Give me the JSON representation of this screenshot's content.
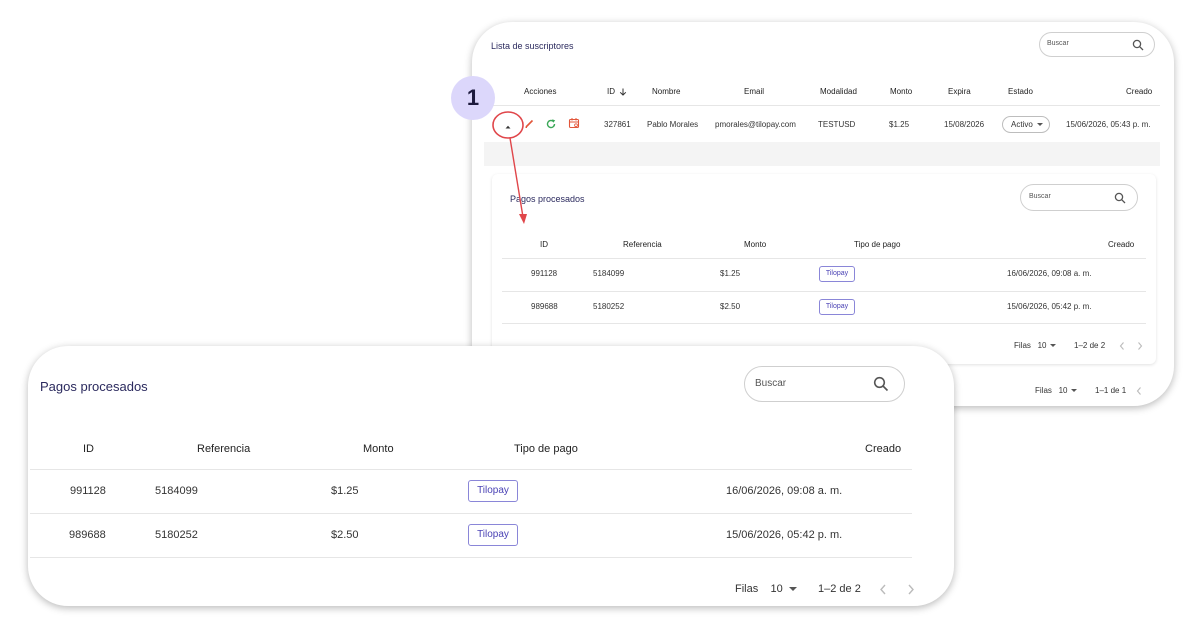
{
  "subscribers": {
    "title": "Lista de suscriptores",
    "search_placeholder": "Buscar",
    "columns": [
      "Acciones",
      "ID",
      "Nombre",
      "Email",
      "Modalidad",
      "Monto",
      "Expira",
      "Estado",
      "Creado"
    ],
    "id_sort_icon": "arrow-down-icon",
    "row": {
      "id": "327861",
      "name": "Pablo Morales",
      "email": "pmorales@tilopay.com",
      "modality": "TESTUSD",
      "amount": "$1.25",
      "expires": "15/08/2026",
      "status": "Activo",
      "created": "15/06/2026, 05:43 p. m."
    },
    "action_icons": [
      "collapse-icon",
      "edit-icon",
      "refresh-icon",
      "calendar-icon"
    ],
    "footer": {
      "rows_label": "Filas",
      "rows_value": "10",
      "range": "1–1 de 1"
    }
  },
  "payments": {
    "title": "Pagos procesados",
    "search_placeholder": "Buscar",
    "columns": [
      "ID",
      "Referencia",
      "Monto",
      "Tipo de pago",
      "Creado"
    ],
    "rows": [
      {
        "id": "991128",
        "reference": "5184099",
        "amount": "$1.25",
        "type": "Tilopay",
        "created": "16/06/2026, 09:08 a. m."
      },
      {
        "id": "989688",
        "reference": "5180252",
        "amount": "$2.50",
        "type": "Tilopay",
        "created": "15/06/2026, 05:42 p. m."
      }
    ],
    "footer": {
      "rows_label": "Filas",
      "rows_value": "10",
      "range": "1–2 de 2"
    }
  },
  "step_number": "1",
  "colors": {
    "accent": "#4b43b5",
    "step_circle": "#dcd7fb",
    "annotation": "#e0464a",
    "refresh": "#3aa757",
    "edit_calendar": "#e2563a"
  }
}
